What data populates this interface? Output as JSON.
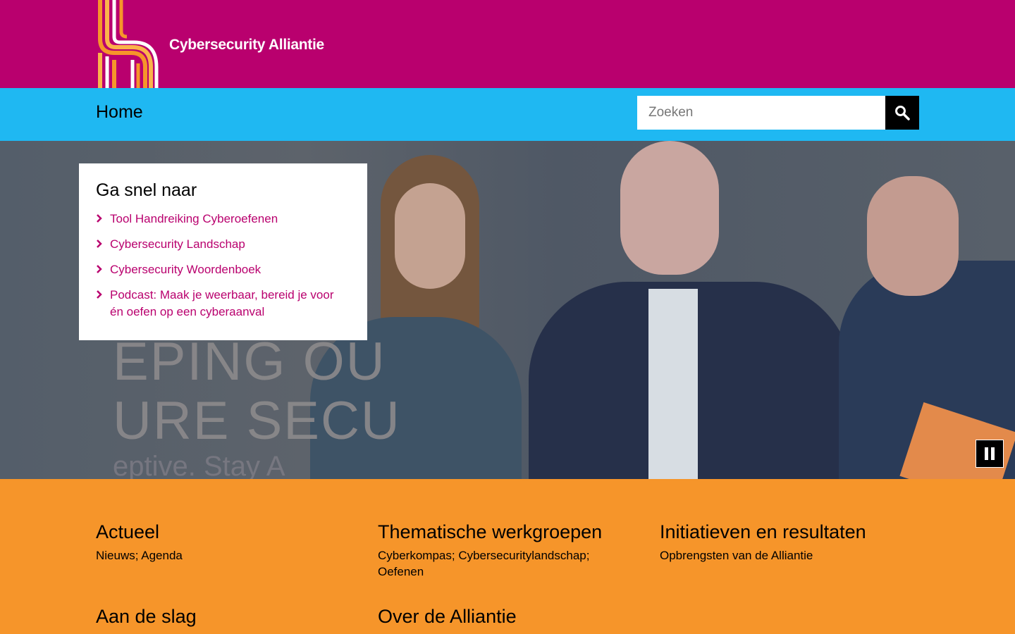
{
  "header": {
    "site_name": "Cybersecurity Alliantie",
    "brand_color": "#b9006e",
    "logo_colors": [
      "#f6952a",
      "#fbb34b",
      "#ffffff"
    ]
  },
  "nav": {
    "home_label": "Home",
    "search_placeholder": "Zoeken",
    "search_icon": "search-icon",
    "bar_color": "#1fb8f2"
  },
  "hero": {
    "background_text_lines": [
      "EPING OU",
      "URE SECU"
    ],
    "background_subtext": "eptive. Stay A",
    "pause_icon": "pause-icon"
  },
  "quick_links": {
    "title": "Ga snel naar",
    "items": [
      {
        "label": "Tool Handreiking Cyberoefenen"
      },
      {
        "label": "Cybersecurity Landschap"
      },
      {
        "label": "Cybersecurity Woordenboek"
      },
      {
        "label": "Podcast: Maak je weerbaar, bereid je voor én oefen op een cyberaanval"
      }
    ],
    "link_color": "#b9006e"
  },
  "sections": [
    {
      "title": "Actueel",
      "links": [
        "Nieuws",
        "Agenda"
      ]
    },
    {
      "title": "Thematische werkgroepen",
      "links": [
        "Cyberkompas",
        "Cybersecuritylandschap",
        "Oefenen"
      ]
    },
    {
      "title": "Initiatieven en resultaten",
      "links": [
        "Opbrengsten van de Alliantie"
      ]
    },
    {
      "title": "Aan de slag",
      "links": []
    },
    {
      "title": "Over de Alliantie",
      "links": []
    }
  ],
  "footer_color": "#f6952a"
}
